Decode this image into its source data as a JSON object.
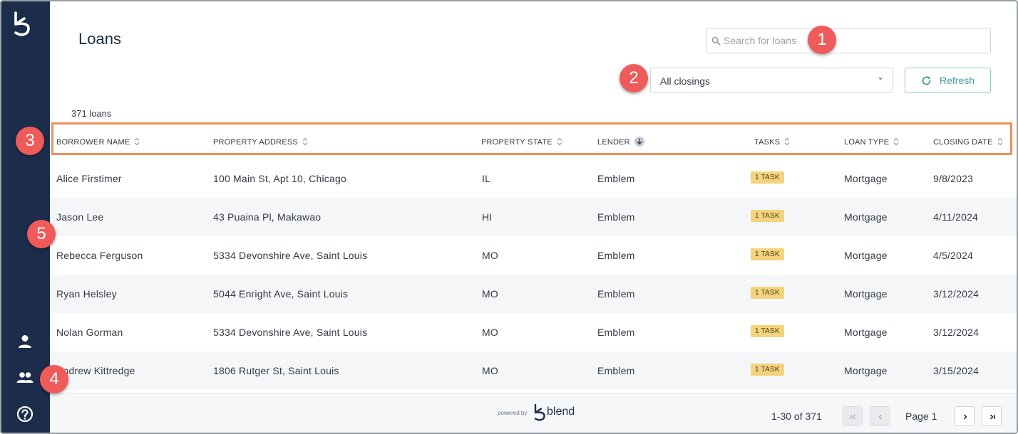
{
  "header": {
    "title": "Loans",
    "search_placeholder": "Search for loans",
    "filter_value": "All closings",
    "refresh_label": "Refresh"
  },
  "loan_count": "371 loans",
  "table": {
    "columns": [
      {
        "label": "BORROWER NAME",
        "sort": "none"
      },
      {
        "label": "PROPERTY ADDRESS",
        "sort": "none"
      },
      {
        "label": "PROPERTY STATE",
        "sort": "none"
      },
      {
        "label": "LENDER",
        "sort": "descending"
      },
      {
        "label": "TASKS",
        "sort": "none"
      },
      {
        "label": "LOAN TYPE",
        "sort": "none"
      },
      {
        "label": "CLOSING DATE",
        "sort": "none"
      }
    ],
    "rows": [
      {
        "borrower": "Alice Firstimer",
        "address": "100 Main St, Apt 10, Chicago",
        "state": "IL",
        "lender": "Emblem",
        "tasks": "1 TASK",
        "loan_type": "Mortgage",
        "closing_date": "9/8/2023"
      },
      {
        "borrower": "Jason Lee",
        "address": "43 Puaina Pl, Makawao",
        "state": "HI",
        "lender": "Emblem",
        "tasks": "1 TASK",
        "loan_type": "Mortgage",
        "closing_date": "4/11/2024"
      },
      {
        "borrower": "Rebecca Ferguson",
        "address": "5334 Devonshire Ave, Saint Louis",
        "state": "MO",
        "lender": "Emblem",
        "tasks": "1 TASK",
        "loan_type": "Mortgage",
        "closing_date": "4/5/2024"
      },
      {
        "borrower": "Ryan Helsley",
        "address": "5044 Enright Ave, Saint Louis",
        "state": "MO",
        "lender": "Emblem",
        "tasks": "1 TASK",
        "loan_type": "Mortgage",
        "closing_date": "3/12/2024"
      },
      {
        "borrower": "Nolan Gorman",
        "address": "5334 Devonshire Ave, Saint Louis",
        "state": "MO",
        "lender": "Emblem",
        "tasks": "1 TASK",
        "loan_type": "Mortgage",
        "closing_date": "3/12/2024"
      },
      {
        "borrower": "Andrew Kittredge",
        "address": "1806 Rutger St, Saint Louis",
        "state": "MO",
        "lender": "Emblem",
        "tasks": "1 TASK",
        "loan_type": "Mortgage",
        "closing_date": "3/15/2024"
      }
    ]
  },
  "footer": {
    "powered_by": "powered by",
    "brand": "blend",
    "range": "1-30 of 371",
    "page_label": "Page 1"
  },
  "callouts": [
    "1",
    "2",
    "3",
    "4",
    "5"
  ],
  "colors": {
    "sidebar": "#1b2d4b",
    "callout": "#ef5b5b",
    "highlight_border": "#f0905a",
    "task_badge": "#f5d37e",
    "accent_teal": "#4a98a0"
  },
  "icons": {
    "sidebar": [
      "blend-logo-icon",
      "person-icon",
      "people-icon",
      "help-icon"
    ],
    "search": "search-icon",
    "refresh": "refresh-icon",
    "sort": "sort-updown-icon"
  }
}
